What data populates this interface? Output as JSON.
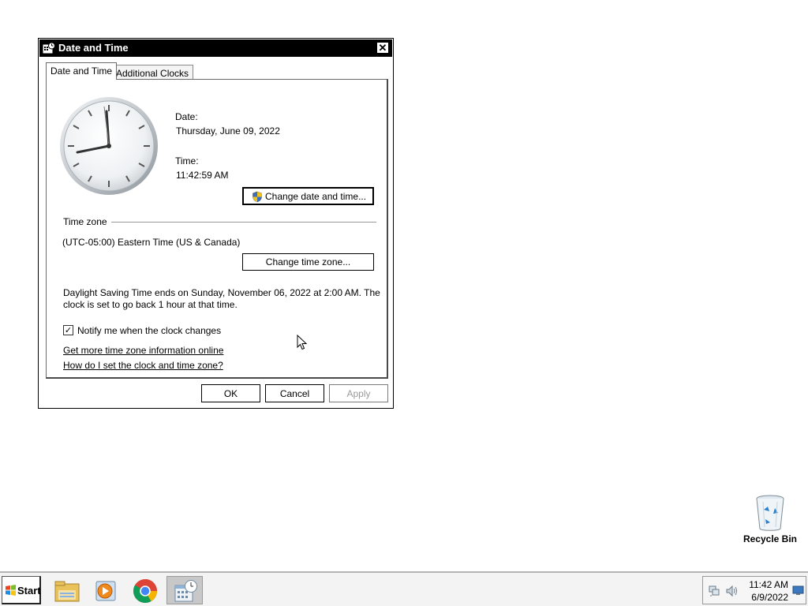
{
  "dialog": {
    "title": "Date and Time",
    "close_label": "✕",
    "tabs": [
      {
        "label": "Date and Time",
        "active": true
      },
      {
        "label": "Additional Clocks",
        "active": false
      }
    ],
    "date_label": "Date:",
    "date_value": "Thursday, June 09, 2022",
    "time_label": "Time:",
    "time_value": "11:42:59 AM",
    "change_datetime_button": "Change date and time...",
    "timezone_heading": "Time zone",
    "timezone_value": "(UTC-05:00) Eastern Time (US & Canada)",
    "change_timezone_button": "Change time zone...",
    "dst_line1": "Daylight Saving Time ends on Sunday, November 06, 2022 at 2:00 AM. The",
    "dst_line2": "clock is set to go back 1 hour at that time.",
    "notify_checkbox_label": "Notify me when the clock changes",
    "notify_checked": true,
    "link_more_info": "Get more time zone information online",
    "link_how_to": "How do I set the clock and time zone?",
    "ok_button": "OK",
    "cancel_button": "Cancel",
    "apply_button": "Apply"
  },
  "desktop": {
    "recycle_bin_label": "Recycle Bin"
  },
  "taskbar": {
    "start_label": "Start",
    "items": [
      "file-explorer-icon",
      "media-player-icon",
      "chrome-icon",
      "date-time-app-icon"
    ],
    "tray_time": "11:42 AM",
    "tray_date": "6/9/2022"
  },
  "colors": {
    "titlebar": "#000000",
    "desktop": "#ffffff",
    "taskbar": "#f3f3f3"
  }
}
